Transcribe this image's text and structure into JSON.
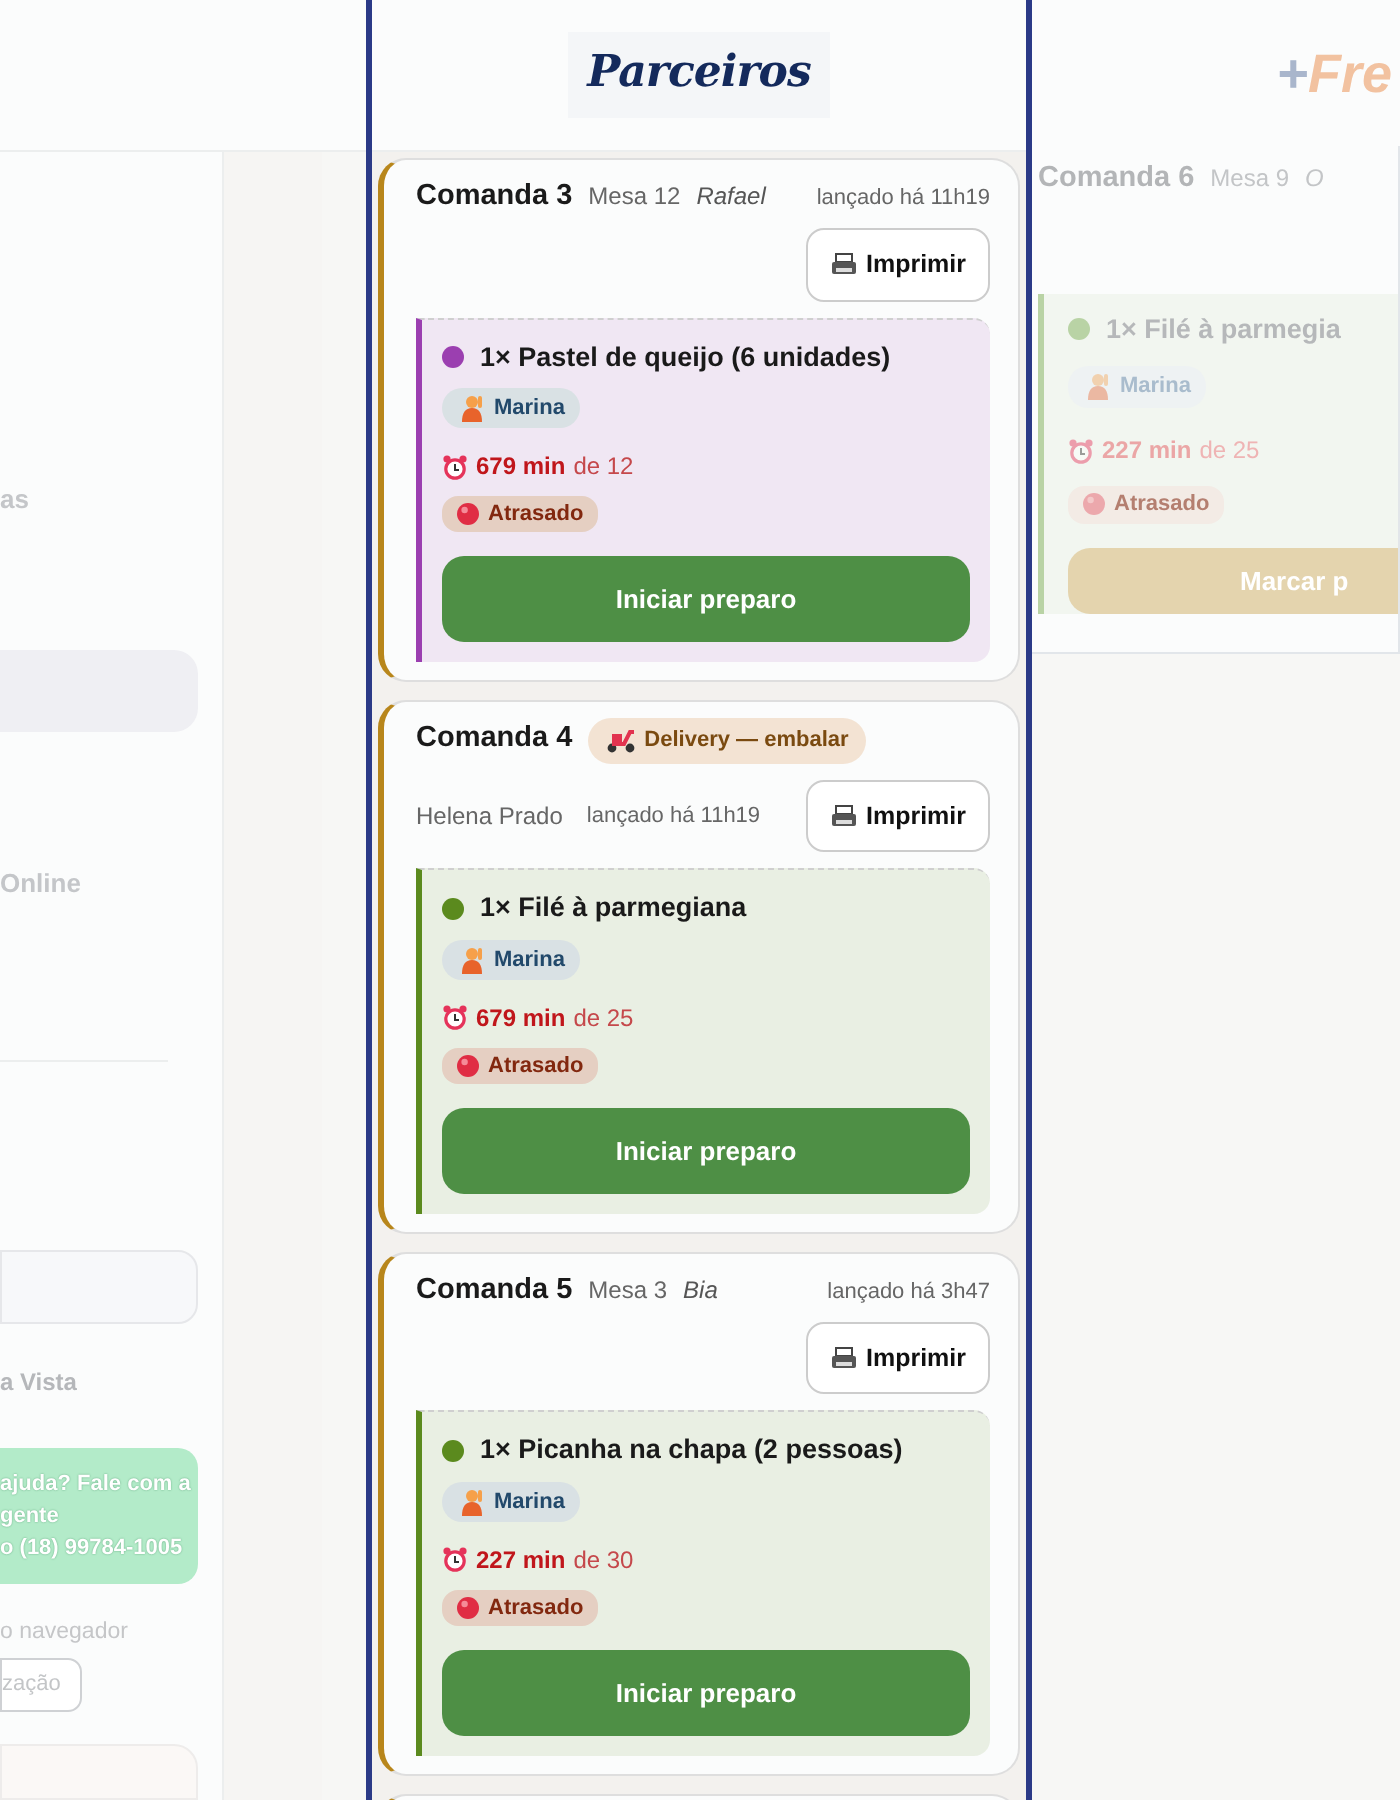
{
  "background": {
    "logo": {
      "plus": "+",
      "text": "Fre"
    },
    "sidebar": {
      "items": [
        {
          "label": "as",
          "kind": "link"
        },
        {
          "kind": "highlight"
        },
        {
          "label": "Online",
          "kind": "link"
        },
        {
          "kind": "divider"
        },
        {
          "kind": "field"
        },
        {
          "label": "a Vista",
          "kind": "heading"
        }
      ]
    },
    "help": {
      "lines": [
        "ajuda? Fale com a",
        "gente",
        "o (18) 99784-1005"
      ]
    },
    "browser_note": "o navegador",
    "browser_button": "zação",
    "side_order": {
      "title": "Comanda 6",
      "table": "Mesa 9",
      "waiter": "O",
      "item": {
        "name": "1× Filé à parmegia",
        "color": "#b9d3a5",
        "cook": "Marina",
        "elapsed": "227 min",
        "target": "de 25",
        "status": "Atrasado",
        "action": "Marcar p"
      }
    }
  },
  "panel": {
    "logo": "Parceiros",
    "orders": [
      {
        "kind": "mesa",
        "title": "Comanda 3",
        "table": "Mesa 12",
        "waiter": "Rafael",
        "launched": "lançado há 11h19",
        "print": "Imprimir",
        "items": [
          {
            "name": "1× Pastel de queijo (6 unidades)",
            "color": "#9b3fb0",
            "cook": "Marina",
            "elapsed": "679 min",
            "target": "de 12",
            "status": "Atrasado",
            "action": "Iniciar preparo"
          }
        ]
      },
      {
        "kind": "delivery",
        "title": "Comanda 4",
        "tag": "Delivery — embalar",
        "customer": "Helena Prado",
        "launched": "lançado há 11h19",
        "print": "Imprimir",
        "items": [
          {
            "name": "1× Filé à parmegiana",
            "color": "#5b8a1e",
            "cook": "Marina",
            "elapsed": "679 min",
            "target": "de 25",
            "status": "Atrasado",
            "action": "Iniciar preparo"
          }
        ]
      },
      {
        "kind": "mesa",
        "title": "Comanda 5",
        "table": "Mesa 3",
        "waiter": "Bia",
        "launched": "lançado há 3h47",
        "print": "Imprimir",
        "items": [
          {
            "name": "1× Picanha na chapa (2 pessoas)",
            "color": "#5b8a1e",
            "cook": "Marina",
            "elapsed": "227 min",
            "target": "de 30",
            "status": "Atrasado",
            "action": "Iniciar preparo"
          }
        ]
      }
    ]
  }
}
